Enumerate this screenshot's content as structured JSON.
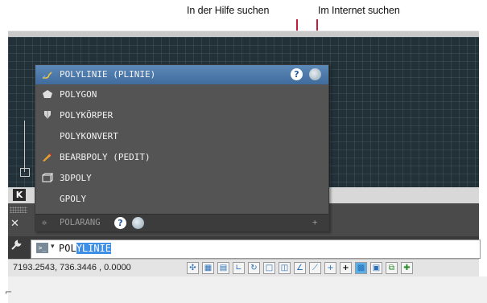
{
  "callouts": {
    "help": "In der Hilfe suchen",
    "internet": "Im Internet suchen"
  },
  "autocomplete": {
    "items": [
      {
        "label": "POLYLINIE (PLINIE)",
        "icon": "polyline-icon",
        "selected": true
      },
      {
        "label": "POLYGON",
        "icon": "polygon-icon"
      },
      {
        "label": "POLYKÖRPER",
        "icon": "polysolid-icon"
      },
      {
        "label": "POLYKONVERT",
        "icon": ""
      },
      {
        "label": "BEARBPOLY (PEDIT)",
        "icon": "pedit-icon"
      },
      {
        "label": "3DPOLY",
        "icon": "3dpoly-icon"
      },
      {
        "label": "GPOLY",
        "icon": ""
      }
    ],
    "system_variable": {
      "label": "POLARANG",
      "icon": "gear-icon"
    },
    "plus": "+"
  },
  "command_line": {
    "prompt_icon": "command-prompt-icon",
    "typed": "POL",
    "completion": "YLINIE",
    "close_symbol": "✕",
    "customize_icon": "wrench-icon"
  },
  "layout_tab": {
    "label": "K"
  },
  "status_bar": {
    "coordinates": "7193.2543, 736.3446 , 0.0000"
  },
  "colors": {
    "drawing_background": "#223038",
    "popup_background": "#545454",
    "selection": "#4f7cad",
    "callout_line": "#c41a3e",
    "completion_highlight": "#3f8fe6"
  }
}
